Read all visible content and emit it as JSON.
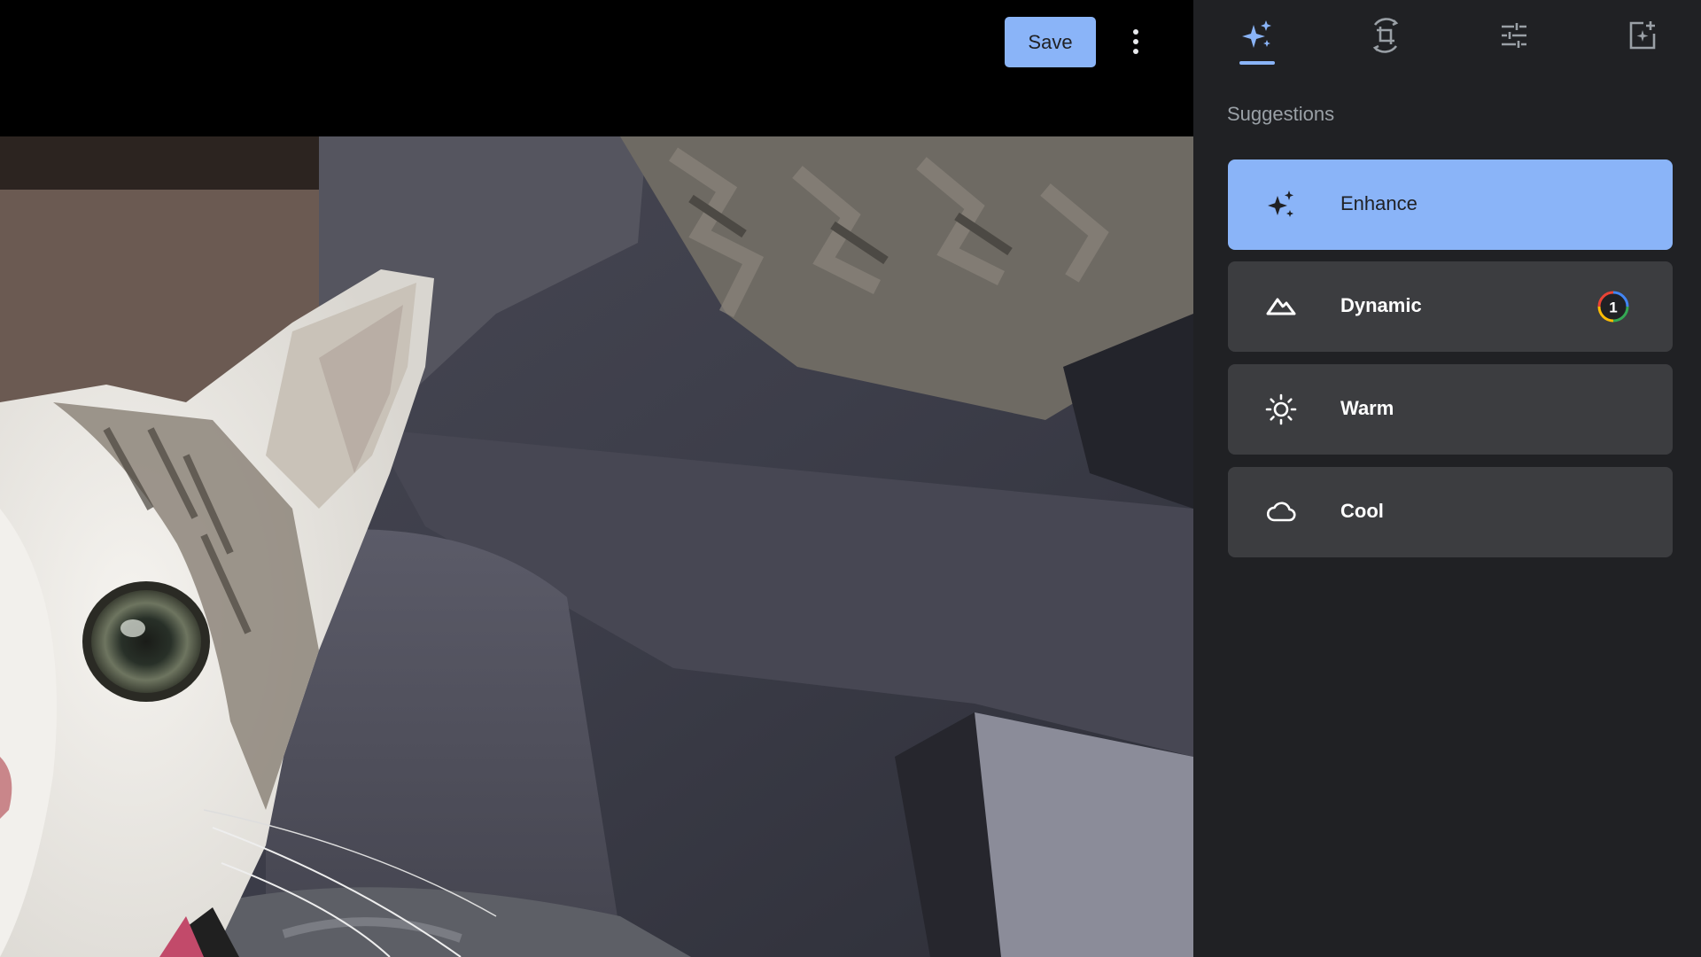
{
  "toolbar": {
    "save_label": "Save",
    "more_icon": "more-vertical-icon"
  },
  "tabs": [
    {
      "icon": "auto-fix-sparkle-icon",
      "selected": true
    },
    {
      "icon": "crop-rotate-icon",
      "selected": false
    },
    {
      "icon": "adjust-sliders-icon",
      "selected": false
    },
    {
      "icon": "add-to-frame-icon",
      "selected": false
    }
  ],
  "panel": {
    "section_title": "Suggestions",
    "suggestions": [
      {
        "label": "Enhance",
        "icon": "sparkle-icon",
        "selected": true
      },
      {
        "label": "Dynamic",
        "icon": "mountain-icon",
        "selected": false,
        "badge": "1"
      },
      {
        "label": "Warm",
        "icon": "sun-icon",
        "selected": false
      },
      {
        "label": "Cool",
        "icon": "cloud-icon",
        "selected": false
      }
    ]
  },
  "colors": {
    "accent": "#8ab4f8",
    "panel_bg": "#202124",
    "card_bg": "#3c3d40",
    "muted_text": "#9aa0a6"
  }
}
